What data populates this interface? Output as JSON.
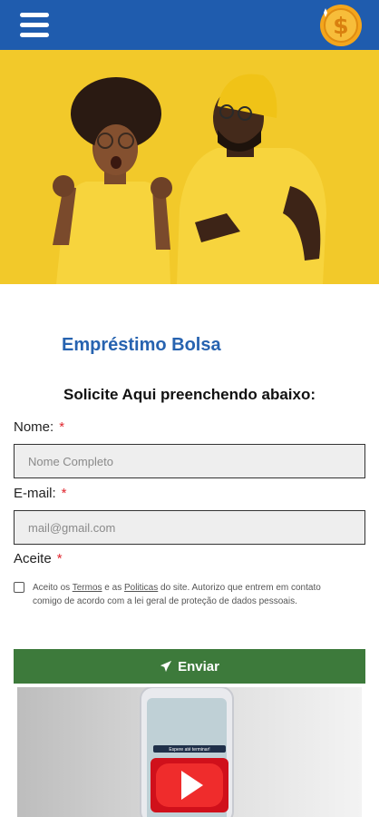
{
  "header": {
    "menu_icon": "hamburger-menu-icon",
    "coin_icon": "dollar-coin-icon"
  },
  "hero": {
    "image": "two people in yellow shirts celebrating"
  },
  "main": {
    "title": "Empréstimo Bolsa",
    "subtitle": "Solicite Aqui preenchendo abaixo:"
  },
  "form": {
    "name_label": "Nome:",
    "name_placeholder": "Nome Completo",
    "email_label": "E-mail:",
    "email_placeholder": "mail@gmail.com",
    "accept_label": "Aceite",
    "required_mark": "*",
    "consent": {
      "part1": "Aceito os ",
      "terms_link": "Termos",
      "part2": " e as ",
      "policies_link": "Politicas",
      "part3": " do site. Autorizo que entrem em contato comigo de acordo com a lei geral de proteção de dados pessoais."
    },
    "submit_label": "Enviar",
    "submit_icon": "paper-plane-icon"
  },
  "video": {
    "screen_caption": "Espere até terminar!",
    "play_icon": "youtube-play-icon"
  },
  "colors": {
    "header": "#1f5cae",
    "title": "#2763b0",
    "submit": "#3d7a3b",
    "required": "#e0262e",
    "hero": "#f2c92a"
  }
}
